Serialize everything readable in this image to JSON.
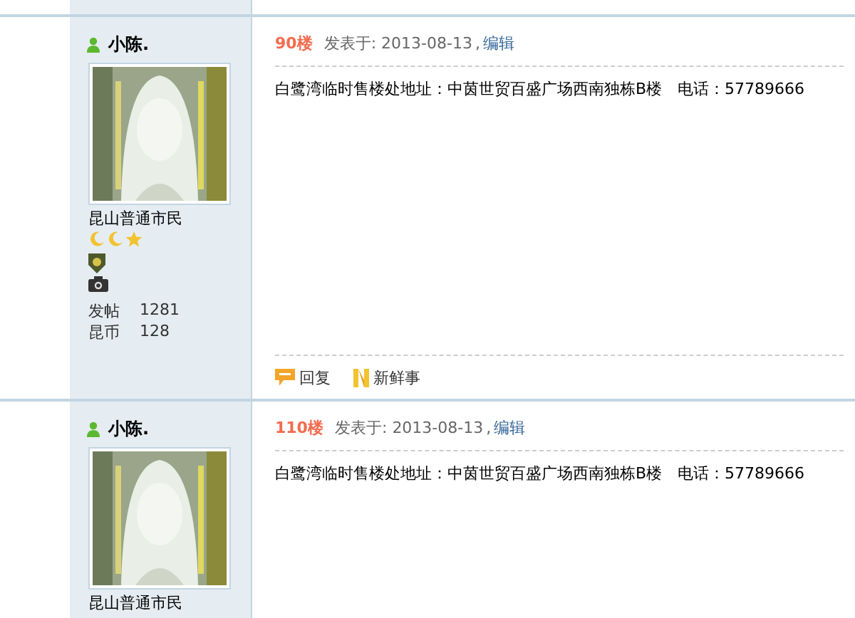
{
  "posts": [
    {
      "author": "小陈.",
      "rank": "昆山普通市民",
      "separator": ",",
      "stats": [
        {
          "label": "发帖",
          "value": "1281"
        },
        {
          "label": "昆币",
          "value": "128"
        }
      ],
      "floor": "90楼",
      "posted_label": "发表于:",
      "date": "2013-08-13",
      "edit_link": "编辑",
      "body": "白鹭湾临时售楼处地址：中茵世贸百盛广场西南独栋B楼　电话：57789666",
      "actions": [
        {
          "kind": "reply",
          "label": "回复"
        },
        {
          "kind": "news",
          "label": "新鲜事"
        }
      ]
    },
    {
      "author": "小陈.",
      "rank": "昆山普通市民",
      "separator": ",",
      "floor": "110楼",
      "posted_label": "发表于:",
      "date": "2013-08-13",
      "edit_link": "编辑",
      "body": "白鹭湾临时售楼处地址：中茵世贸百盛广场西南独栋B楼　电话：57789666"
    }
  ]
}
